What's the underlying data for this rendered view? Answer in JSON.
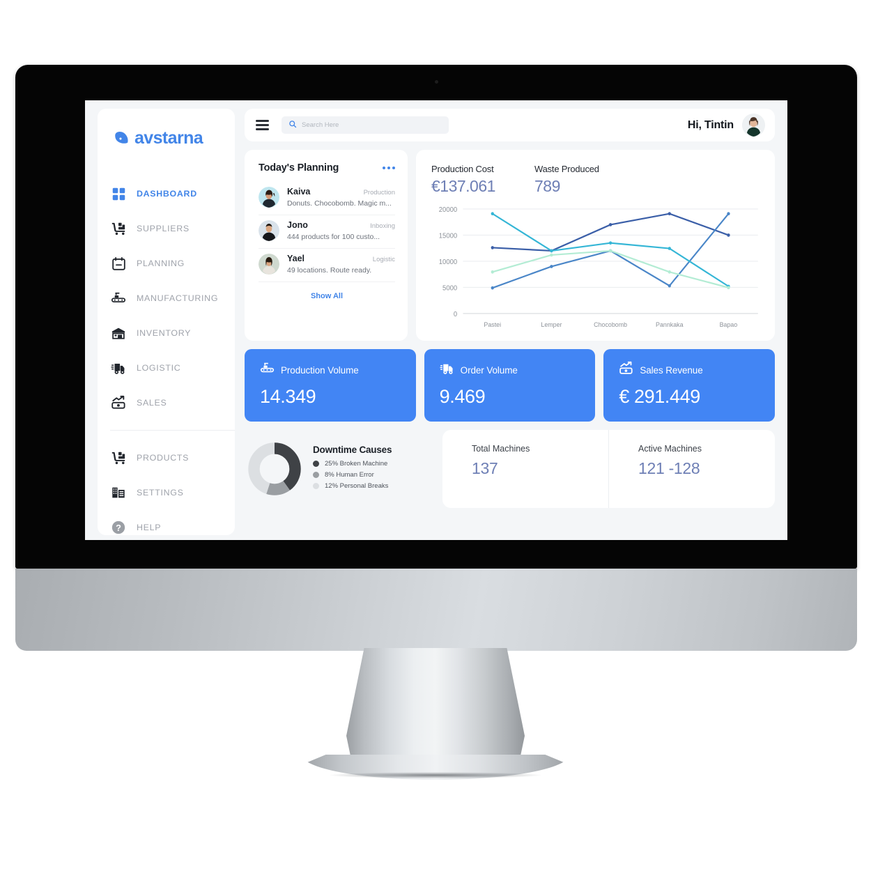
{
  "brand": {
    "name": "avstarna",
    "color": "#4285e8"
  },
  "sidebar": {
    "items": [
      {
        "label": "DASHBOARD",
        "icon": "grid-icon",
        "active": true
      },
      {
        "label": "SUPPLIERS",
        "icon": "pallet-truck-icon",
        "active": false
      },
      {
        "label": "PLANNING",
        "icon": "calendar-icon",
        "active": false
      },
      {
        "label": "MANUFACTURING",
        "icon": "conveyor-icon",
        "active": false
      },
      {
        "label": "INVENTORY",
        "icon": "warehouse-icon",
        "active": false
      },
      {
        "label": "LOGISTIC",
        "icon": "delivery-truck-icon",
        "active": false
      },
      {
        "label": "SALES",
        "icon": "money-chart-icon",
        "active": false
      }
    ],
    "items_secondary": [
      {
        "label": "PRODUCTS",
        "icon": "pallet-truck-icon"
      },
      {
        "label": "SETTINGS",
        "icon": "building-icon"
      },
      {
        "label": "HELP",
        "icon": "question-circle-icon"
      }
    ]
  },
  "topbar": {
    "menu_icon": "hamburger-icon",
    "search": {
      "placeholder": "Search Here",
      "value": "",
      "icon": "search-icon"
    },
    "greeting": "Hi, Tintin",
    "avatar": "user-avatar"
  },
  "planning": {
    "title": "Today's Planning",
    "more_icon": "ellipsis-icon",
    "show_all": "Show All",
    "rows": [
      {
        "name": "Kaiva",
        "tag": "Production",
        "desc": "Donuts. Chocobomb. Magic m..."
      },
      {
        "name": "Jono",
        "tag": "Inboxing",
        "desc": "444 products for 100 custo..."
      },
      {
        "name": "Yael",
        "tag": "Logistic",
        "desc": "49 locations. Route ready."
      }
    ]
  },
  "kpis": [
    {
      "label": "Production Cost",
      "value": "€137.061"
    },
    {
      "label": "Waste Produced",
      "value": "789"
    }
  ],
  "stat_cards": [
    {
      "label": "Production Volume",
      "value": "14.349",
      "icon": "conveyor-icon",
      "color": "#4285f4"
    },
    {
      "label": "Order Volume",
      "value": "9.469",
      "icon": "delivery-truck-icon",
      "color": "#4285f4"
    },
    {
      "label": "Sales Revenue",
      "value": "€ 291.449",
      "icon": "money-chart-icon",
      "color": "#4285f4"
    }
  ],
  "downtime": {
    "title": "Downtime Causes",
    "legend": [
      {
        "label": "25% Broken Machine",
        "color": "#3f4246",
        "value": 25
      },
      {
        "label": "8% Human Error",
        "color": "#9a9ea2",
        "value": 8
      },
      {
        "label": "12% Personal Breaks",
        "color": "#dcdfe2",
        "value": 12
      }
    ]
  },
  "machines": [
    {
      "label": "Total Machines",
      "value": "137"
    },
    {
      "label": "Active Machines",
      "value": "121 -128"
    }
  ],
  "chart_data": {
    "type": "line",
    "title": "",
    "xlabel": "",
    "ylabel": "",
    "categories": [
      "Pastei",
      "Lemper",
      "Chocobomb",
      "Pannkaka",
      "Bapao"
    ],
    "ylim": [
      0,
      20000
    ],
    "yticks": [
      0,
      5000,
      10000,
      15000,
      20000
    ],
    "grid": true,
    "legend": "none",
    "series": [
      {
        "name": "Series 1",
        "color": "#3b5fa8",
        "values": [
          12600,
          12000,
          17000,
          19100,
          15000
        ]
      },
      {
        "name": "Series 2",
        "color": "#4a86c8",
        "values": [
          4900,
          9000,
          12000,
          5300,
          19100
        ]
      },
      {
        "name": "Series 3",
        "color": "#35b6d6",
        "values": [
          19100,
          12000,
          13500,
          12450,
          5200
        ]
      },
      {
        "name": "Series 4",
        "color": "#b3ecd4",
        "values": [
          7950,
          11200,
          12000,
          7950,
          4950
        ]
      }
    ]
  }
}
